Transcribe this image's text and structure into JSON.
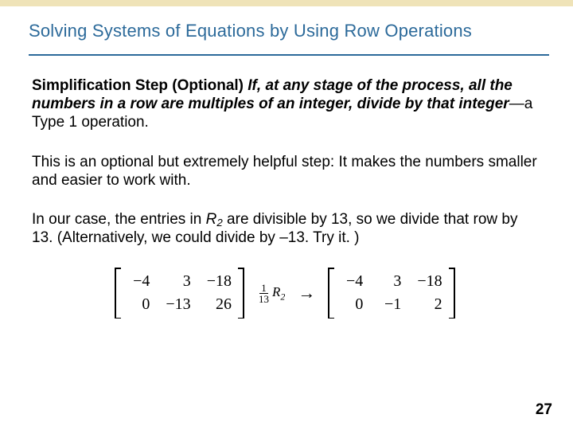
{
  "title": "Solving Systems of Equations by Using Row Operations",
  "para1": {
    "lead": "Simplification Step (Optional) ",
    "mid": "If, at any stage of the process, all the numbers in a row are multiples of an integer, divide by that integer",
    "tail": "—a Type 1 operation."
  },
  "para2": "This is an optional but extremely helpful step: It makes the numbers smaller and easier to work with.",
  "para3_a": "In our case, the entries in ",
  "para3_R": "R",
  "para3_Rsub": "2",
  "para3_b": " are divisible by 13, so we divide that row by 13. (Alternatively, we could divide by –13. Try it. )",
  "matrix_before": {
    "r1": [
      "−4",
      "3",
      "−18"
    ],
    "r2": [
      "0",
      "−13",
      "26"
    ]
  },
  "op": {
    "frac_num": "1",
    "frac_den": "13",
    "R": "R",
    "Rsub": "2"
  },
  "arrow": "→",
  "matrix_after": {
    "r1": [
      "−4",
      "3",
      "−18"
    ],
    "r2": [
      "0",
      "−1",
      "2"
    ]
  },
  "page_number": "27"
}
